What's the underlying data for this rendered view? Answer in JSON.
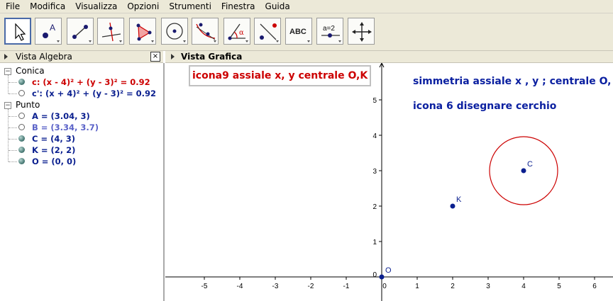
{
  "menu": [
    "File",
    "Modifica",
    "Visualizza",
    "Opzioni",
    "Strumenti",
    "Finestra",
    "Guida"
  ],
  "toolbar": {
    "tools": [
      {
        "name": "move-tool",
        "icon": "arrow-pointer-icon",
        "selected": true
      },
      {
        "name": "new-point-tool",
        "icon": "point-icon"
      },
      {
        "name": "line-through-two-points-tool",
        "icon": "segment-icon"
      },
      {
        "name": "perpendicular-line-tool",
        "icon": "perpendicular-icon"
      },
      {
        "name": "polygon-tool",
        "icon": "polygon-icon"
      },
      {
        "name": "circle-center-point-tool",
        "icon": "circle-icon"
      },
      {
        "name": "conic-tool",
        "icon": "conic-icon"
      },
      {
        "name": "angle-tool",
        "icon": "angle-icon"
      },
      {
        "name": "reflect-tool",
        "icon": "reflect-icon"
      },
      {
        "name": "text-tool",
        "icon": "text-icon",
        "label": "ABC"
      },
      {
        "name": "slider-tool",
        "icon": "slider-icon",
        "label": "a=2"
      },
      {
        "name": "move-view-tool",
        "icon": "move-arrows-icon"
      }
    ]
  },
  "algebra": {
    "title": "Vista Algebra",
    "close_label": "×",
    "groups": [
      {
        "label": "Conica",
        "items": [
          {
            "text": "c: (x - 4)² + (y - 3)² = 0.92",
            "color": "#cc0000",
            "marker": "filled"
          },
          {
            "text": "c': (x + 4)² + (y - 3)² = 0.92",
            "color": "#0a1f8f",
            "marker": "hollow"
          }
        ]
      },
      {
        "label": "Punto",
        "items": [
          {
            "text": "A = (3.04, 3)",
            "color": "#0a1f8f",
            "marker": "hollow"
          },
          {
            "text": "B = (3.34, 3.7)",
            "color": "#5a62c8",
            "marker": "hollow"
          },
          {
            "text": "C = (4, 3)",
            "color": "#0a1f8f",
            "marker": "filled"
          },
          {
            "text": "K = (2, 2)",
            "color": "#0a1f8f",
            "marker": "filled"
          },
          {
            "text": "O = (0, 0)",
            "color": "#0a1f8f",
            "marker": "filled"
          }
        ]
      }
    ]
  },
  "graphics": {
    "title": "Vista Grafica",
    "text_box": "icona9 assiale x, y centrale O,K",
    "note1": "simmetria assiale x , y ; centrale O, K",
    "note2": "icona 6 disegnare cerchio",
    "x_ticks": [
      "-5",
      "-4",
      "-3",
      "-2",
      "-1",
      "0",
      "1",
      "2",
      "3",
      "4",
      "5",
      "6"
    ],
    "y_ticks": [
      "1",
      "2",
      "3",
      "4",
      "5"
    ],
    "points": [
      {
        "label": "O",
        "x": 0,
        "y": 0
      },
      {
        "label": "K",
        "x": 2,
        "y": 2
      },
      {
        "label": "C",
        "x": 4,
        "y": 3
      }
    ],
    "circle": {
      "center_x": 4,
      "center_y": 3,
      "radius": 0.96,
      "color": "#cc0000"
    },
    "colors": {
      "point": "#0a1f8f",
      "axis": "#000000",
      "text_red": "#cc0000",
      "text_blue": "#0a1fa0"
    }
  }
}
